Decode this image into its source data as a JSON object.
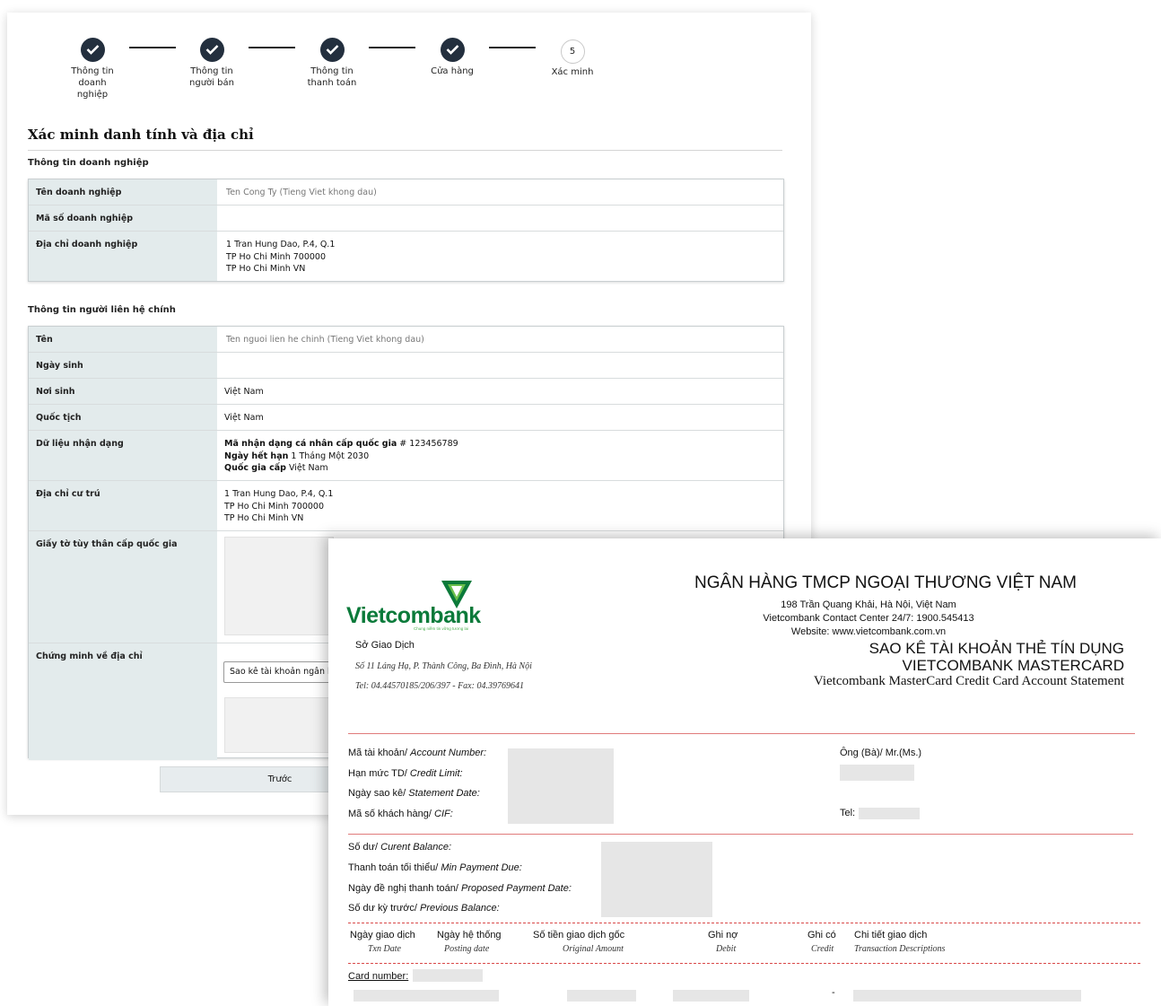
{
  "stepper": {
    "steps": [
      {
        "label_lines": [
          "Thông tin",
          "doanh",
          "nghiệp"
        ],
        "done": true
      },
      {
        "label_lines": [
          "Thông tin",
          "người bán"
        ],
        "done": true
      },
      {
        "label_lines": [
          "Thông tin",
          "thanh toán"
        ],
        "done": true
      },
      {
        "label_lines": [
          "Cửa hàng"
        ],
        "done": true
      },
      {
        "number": "5",
        "label_lines": [
          "Xác minh"
        ],
        "done": false
      }
    ]
  },
  "form": {
    "title": "Xác minh danh tính và địa chỉ",
    "business_section": {
      "title": "Thông tin doanh nghiệp",
      "rows": [
        {
          "label": "Tên doanh nghiệp",
          "placeholder": "Ten Cong Ty (Tieng Viet khong dau)"
        },
        {
          "label": "Mã số doanh nghiệp",
          "value": ""
        },
        {
          "label": "Địa chỉ doanh nghiệp",
          "lines": [
            "1 Tran Hung Dao, P.4, Q.1",
            "TP Ho Chi Minh 700000",
            "TP Ho Chi Minh VN"
          ]
        }
      ]
    },
    "contact_section": {
      "title": "Thông tin người liên hệ chính",
      "name_label": "Tên",
      "name_placeholder": "Ten nguoi lien he chinh (Tieng Viet khong dau)",
      "dob_label": "Ngày sinh",
      "birthplace_label": "Nơi sinh",
      "birthplace_value": "Việt Nam",
      "nationality_label": "Quốc tịch",
      "nationality_value": "Việt Nam",
      "id_label": "Dữ liệu nhận dạng",
      "id_number_label": "Mã nhận dạng cá nhân cấp quốc gia",
      "id_number_value": "# 123456789",
      "id_expiry_label": "Ngày hết hạn",
      "id_expiry_value": "1 Tháng Một 2030",
      "id_country_label": "Quốc gia cấp",
      "id_country_value": "Việt Nam",
      "residence_label": "Địa chỉ cư trú",
      "residence_lines": [
        "1 Tran Hung Dao, P.4, Q.1",
        "TP Ho Chi Minh 700000",
        "TP Ho Chi Minh VN"
      ],
      "national_id_doc_label": "Giấy tờ tùy thân cấp quốc gia",
      "address_proof_label": "Chứng minh về địa chỉ",
      "address_proof_selected": "Sao kê tài khoản ngân hàng"
    },
    "prev_button": "Trước"
  },
  "statement": {
    "logo": "Vietcombank",
    "logo_slogan": "Chung niềm tin vững tương lai",
    "branch": "Sở Giao Dịch",
    "branch_address": "Số 11 Láng Hạ, P. Thành Công, Ba Đình, Hà Nội",
    "branch_phone": "Tel: 04.44570185/206/397  - Fax: 04.39769641",
    "bank_name": "NGÂN HÀNG TMCP NGOẠI THƯƠNG VIỆT NAM",
    "bank_address": "198 Trần Quang Khải, Hà Nội, Việt Nam",
    "contact_center": "Vietcombank Contact Center 24/7: 1900.545413",
    "website": "Website: www.vietcombank.com.vn",
    "title_line1": "SAO KÊ TÀI KHOẢN THẺ TÍN DỤNG",
    "title_line2": "VIETCOMBANK MASTERCARD",
    "title_en": "Vietcombank MasterCard Credit Card Account Statement",
    "account_fields": [
      {
        "vi": "Mã tài khoản/",
        "en": "Account Number:"
      },
      {
        "vi": "Hạn mức TD/",
        "en": "Credit Limit:"
      },
      {
        "vi": "Ngày sao kê/",
        "en": "Statement Date:"
      },
      {
        "vi": "Mã số khách hàng/",
        "en": "CIF:"
      }
    ],
    "customer_label": "Ông (Bà)/ Mr.(Ms.)",
    "tel_label": "Tel:",
    "balance_fields": [
      {
        "vi": "Số dư/",
        "en": "Curent Balance:"
      },
      {
        "vi": "Thanh toán tối thiểu/",
        "en": "Min Payment Due:"
      },
      {
        "vi": "Ngày đề nghị thanh toán/",
        "en": "Proposed Payment Date:"
      },
      {
        "vi": "Số dư kỳ trước/",
        "en": "Previous Balance:"
      }
    ],
    "columns": [
      {
        "vi": "Ngày giao dịch",
        "en": "Txn Date"
      },
      {
        "vi": "Ngày hệ thống",
        "en": "Posting date"
      },
      {
        "vi": "Số tiền giao dịch gốc",
        "en": "Original Amount"
      },
      {
        "vi": "Ghi nợ",
        "en": "Debit"
      },
      {
        "vi": "Ghi có",
        "en": "Credit"
      },
      {
        "vi": "Chi tiết giao dịch",
        "en": "Transaction Descriptions"
      }
    ],
    "card_number_label": "Card number:",
    "row_dash": "-"
  },
  "colors": {
    "step_done": "#232f3e",
    "label_bg": "#e3ebec",
    "vcb_green": "#0b7a3a",
    "statement_rule": "#e07b7b"
  }
}
